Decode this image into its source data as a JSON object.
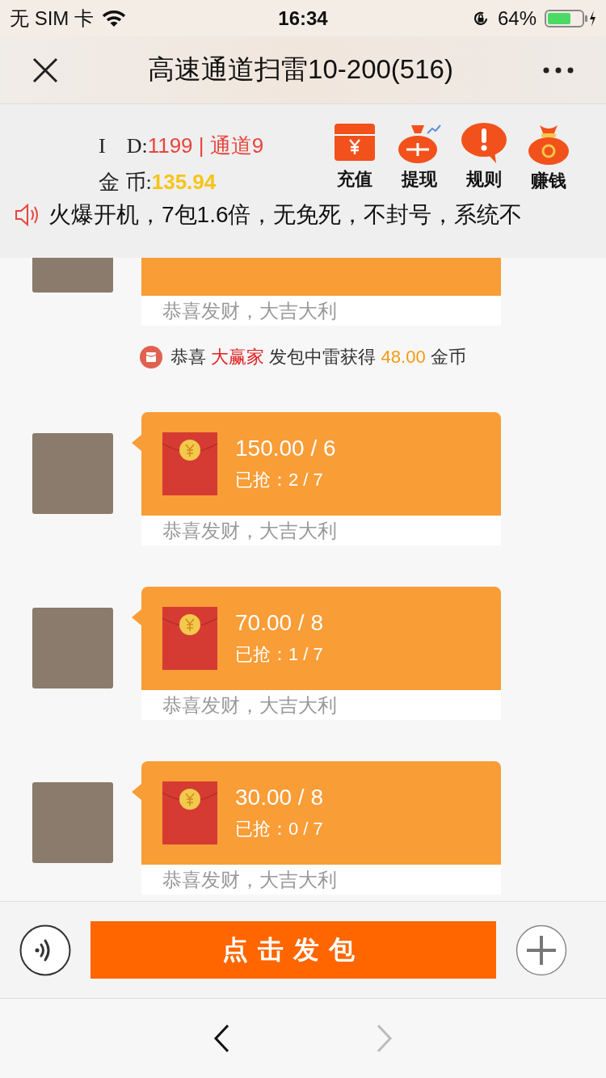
{
  "status_bar": {
    "carrier": "无 SIM 卡",
    "time": "16:34",
    "battery": "64%"
  },
  "nav": {
    "title": "高速通道扫雷10-200(516)"
  },
  "account": {
    "id_label": "I　D:",
    "id_value": "1199 | 通道9",
    "coin_label": "金 币:",
    "coin_value": "135.94"
  },
  "actions": [
    {
      "kind": "recharge",
      "label": "充值"
    },
    {
      "kind": "withdraw",
      "label": "提现"
    },
    {
      "kind": "rules",
      "label": "规则"
    },
    {
      "kind": "earn",
      "label": "赚钱"
    }
  ],
  "notice": {
    "text": "火爆开机，7包1.6倍，无免死，不封号，系统不"
  },
  "messages": [
    {
      "kind": "red_packet",
      "blessing": "恭喜发财，大吉大利"
    },
    {
      "kind": "system",
      "prefix": "恭喜",
      "name": "大赢家",
      "middle": "发包中雷获得",
      "amount": "48.00",
      "suffix": "金币"
    },
    {
      "kind": "red_packet",
      "amount": "150.00 / 6",
      "grabbed": "已抢：2 / 7",
      "blessing": "恭喜发财，大吉大利"
    },
    {
      "kind": "red_packet",
      "amount": "70.00 / 8",
      "grabbed": "已抢：1 / 7",
      "blessing": "恭喜发财，大吉大利"
    },
    {
      "kind": "red_packet",
      "amount": "30.00 / 8",
      "grabbed": "已抢：0 / 7",
      "blessing": "恭喜发财，大吉大利"
    }
  ],
  "send_button": "点击发包",
  "browser_nav": {
    "back_disabled": false,
    "forward_disabled": true
  }
}
